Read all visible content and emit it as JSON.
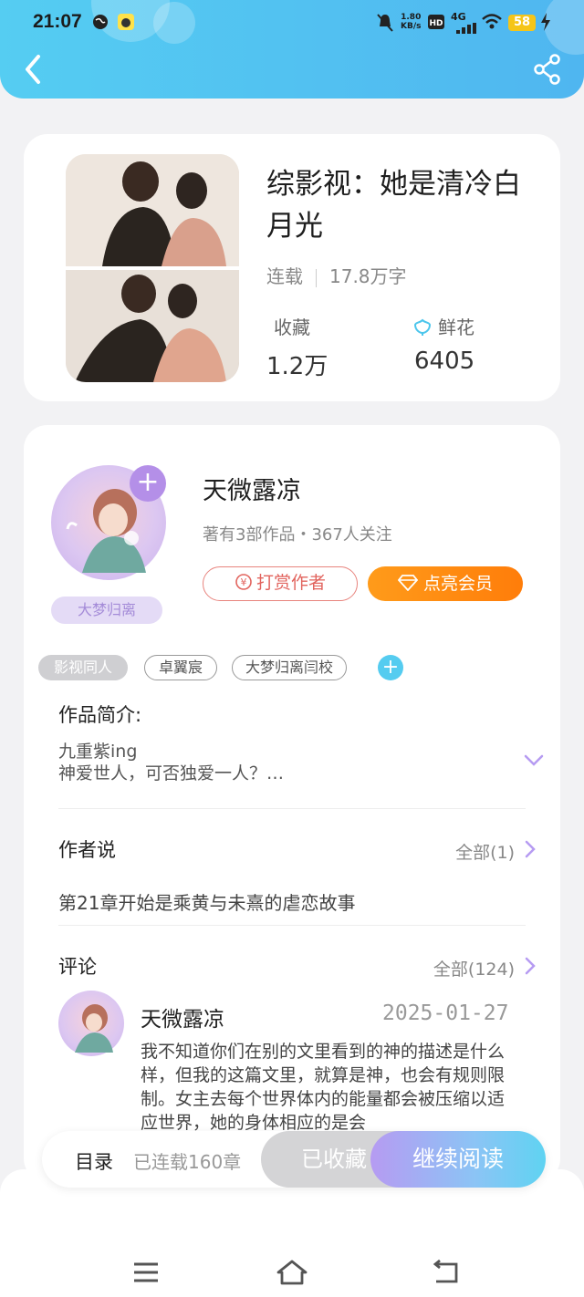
{
  "status_bar": {
    "time": "21:07",
    "net_speed_value": "1.80",
    "net_speed_unit": "KB/s",
    "network": "4G",
    "battery": "58"
  },
  "header": {
    "back_icon": "chevron-left-icon",
    "share_icon": "share-icon"
  },
  "book": {
    "title": "综影视：她是清冷白月光",
    "status": "连载",
    "word_count": "17.8万字",
    "favorites_label": "收藏",
    "favorites_value": "1.2万",
    "flowers_label": "鲜花",
    "flowers_value": "6405"
  },
  "author": {
    "name": "天微露凉",
    "info": "著有3部作品・367人关注",
    "badge": "大梦归离",
    "tip_button": "打赏作者",
    "vip_button": "点亮会员"
  },
  "tags": [
    "影视同人",
    "卓翼宸",
    "大梦归离闫校"
  ],
  "intro": {
    "title": "作品简介:",
    "line1": "九重紫ing",
    "line2": "神爱世人，可否独爱一人？…"
  },
  "author_says": {
    "title": "作者说",
    "more": "全部(1)",
    "text": "第21章开始是乘黄与未熹的虐恋故事"
  },
  "comments": {
    "title": "评论",
    "more": "全部(124)",
    "items": [
      {
        "name": "天微露凉",
        "date": "2025-01-27",
        "text": "我不知道你们在别的文里看到的神的描述是什么样，但我的这篇文里，就算是神，也会有规则限制。女主去每个世界体内的能量都会被压缩以适应世界，她的身体相应的是会"
      }
    ]
  },
  "bottom_bar": {
    "toc": "目录",
    "toc_info": "已连载160章",
    "collected": "已收藏",
    "continue": "继续阅读"
  },
  "colors": {
    "header": "#4fb6f0",
    "accent_orange": "#ff8a12",
    "accent_purple": "#b48fe8",
    "tip_red": "#e2645e"
  }
}
